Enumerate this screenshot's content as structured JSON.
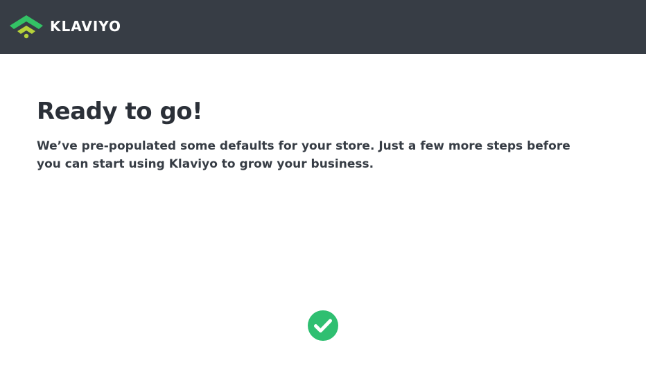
{
  "header": {
    "brand_name": "KLAVIYO",
    "logo_icon": "klaviyo-wifi-icon",
    "colors": {
      "background": "#373d45",
      "logo_green": "#33c165",
      "logo_yellow": "#b6d23a"
    }
  },
  "main": {
    "title": "Ready to go!",
    "subtitle": "We’ve pre-populated some defaults for your store. Just a few more steps before you can start using Klaviyo to grow your business.",
    "status_icon": "check-circle-icon",
    "status_color": "#2fbf71"
  }
}
